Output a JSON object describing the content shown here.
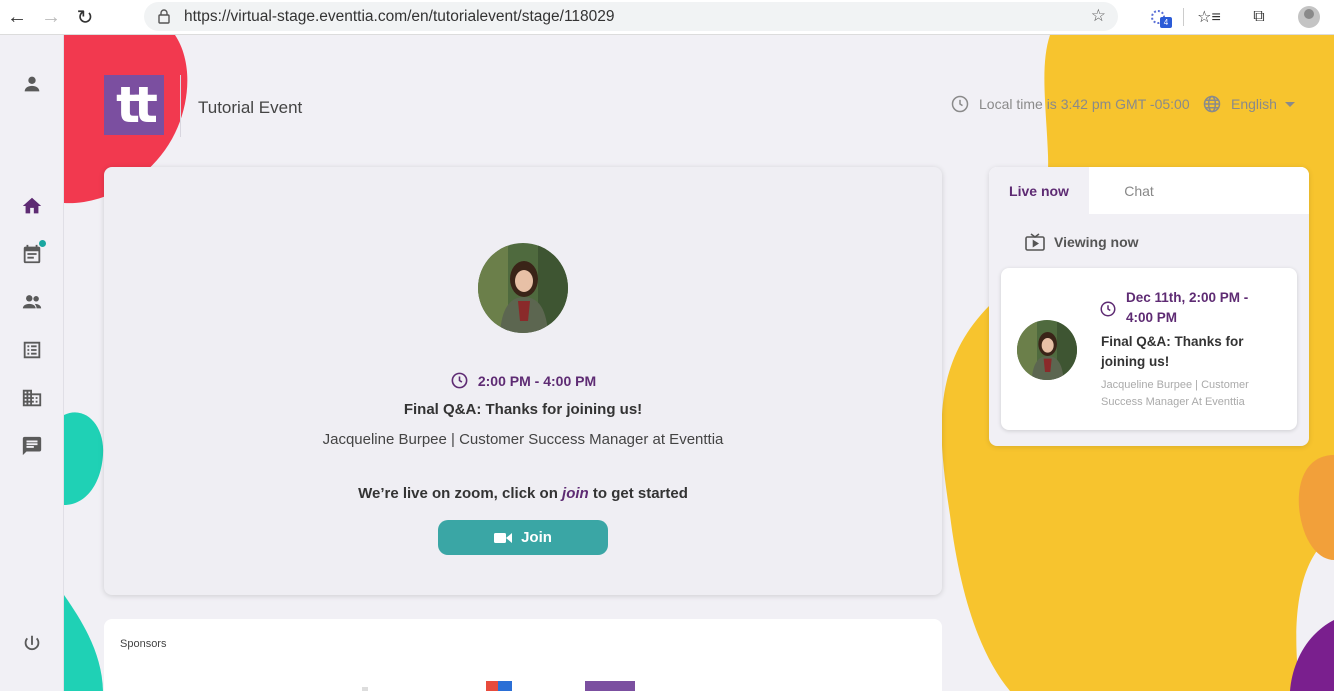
{
  "browser": {
    "url": "https://virtual-stage.eventtia.com/en/tutorialevent/stage/118029",
    "extension_badge": "4"
  },
  "header": {
    "logo_text": "tt",
    "event_title": "Tutorial Event",
    "local_time": "Local time is 3:42 pm GMT -05:00",
    "language": "English"
  },
  "sidebar": {
    "items": [
      "profile",
      "home",
      "agenda",
      "attendees",
      "list",
      "sponsors",
      "chat",
      "logout"
    ]
  },
  "session": {
    "time": "2:00 PM - 4:00 PM",
    "title": "Final Q&A: Thanks for joining us!",
    "speaker": "Jacqueline Burpee | Customer Success Manager at Eventtia",
    "live_prefix": "We’re live on zoom, click on ",
    "live_emphasis": "join",
    "live_suffix": " to get started",
    "join_label": "Join"
  },
  "sponsors": {
    "label": "Sponsors"
  },
  "panel": {
    "tabs": [
      {
        "label": "Live now",
        "active": true
      },
      {
        "label": "Chat",
        "active": false
      }
    ],
    "viewing_label": "Viewing now",
    "item": {
      "time": "Dec 11th, 2:00 PM - 4:00 PM",
      "title": "Final Q&A: Thanks for joining us!",
      "speaker": "Jacqueline Burpee | Customer Success Manager At Eventtia"
    }
  },
  "colors": {
    "brand_purple": "#5e2b73",
    "logo_purple": "#7b4fa0",
    "join_teal": "#3aa6a5",
    "blob_red": "#f2394f",
    "blob_teal": "#1fd1b5",
    "blob_yellow": "#f7c42e",
    "blob_orange": "#f2a03a"
  }
}
